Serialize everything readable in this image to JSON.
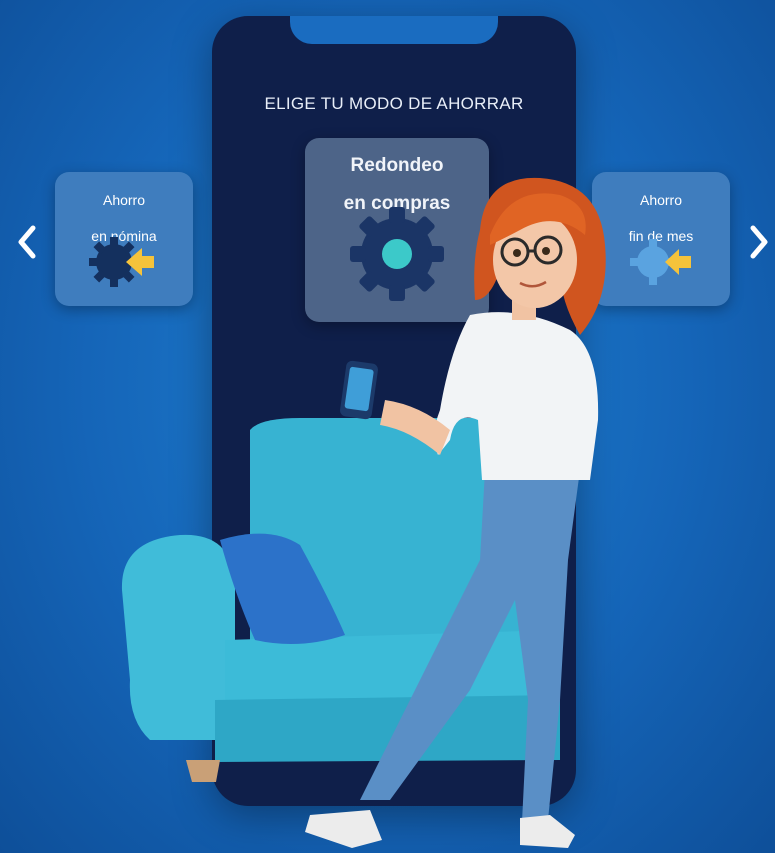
{
  "phone": {
    "title": "ELIGE TU MODO DE AHORRAR"
  },
  "carousel": {
    "left_card": {
      "label_line1": "Ahorro",
      "label_line2": "en nómina",
      "icon": "gear-arrow-icon"
    },
    "center_card": {
      "label_line1": "Redondeo",
      "label_line2": "en compras",
      "icon": "gear-icon"
    },
    "right_card": {
      "label_line1": "Ahorro",
      "label_line2": "fin de mes",
      "icon": "gear-arrow-icon"
    },
    "prev_icon": "chevron-left-icon",
    "next_icon": "chevron-right-icon"
  },
  "colors": {
    "background": "#1565b8",
    "phone": "#0f1f4a",
    "accent_yellow": "#f5c33b",
    "accent_teal": "#3cc9c9",
    "sofa": "#3bb8d6"
  }
}
